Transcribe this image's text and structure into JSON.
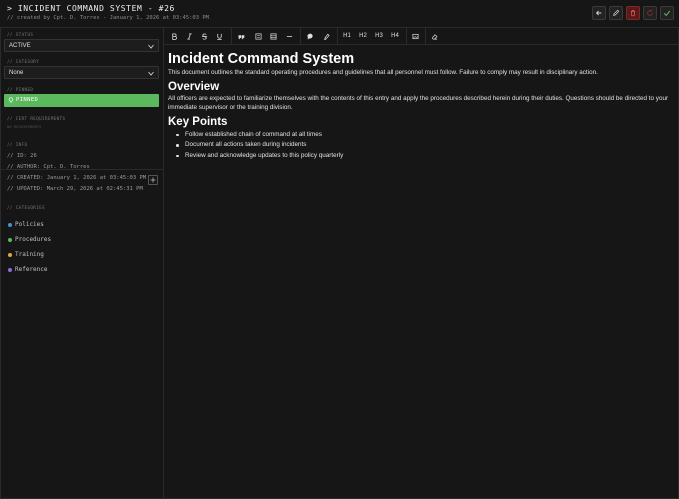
{
  "header": {
    "title": "> INCIDENT COMMAND SYSTEM - #26",
    "subtitle": "// created by Cpt. D. Torres - January 1, 2026 at 03:45:03 PM",
    "buttons": [
      "back-icon",
      "pencil-icon",
      "trash-icon",
      "refresh-icon",
      "check-icon"
    ]
  },
  "sidebar": {
    "status": {
      "label": "// STATUS",
      "value": "ACTIVE"
    },
    "category": {
      "label": "// CATEGORY",
      "value": "None"
    },
    "pinned": {
      "label": "// PINNED",
      "value": "PINNED"
    },
    "cert": {
      "label": "// CERT REQUIREMENTS",
      "value": "NO REQUIREMENTS"
    },
    "info": {
      "label": "// INFO",
      "id": "// ID: 26",
      "author": "// AUTHOR: Cpt. D. Torres",
      "created": "// CREATED: January 1, 2026 at 03:45:03 PM",
      "updated": "// UPDATED: March 29, 2026 at 02:45:31 PM"
    },
    "categories": {
      "label": "// CATEGORIES",
      "items": [
        {
          "name": "Policies",
          "color": "#4a90d9"
        },
        {
          "name": "Procedures",
          "color": "#5cb85c"
        },
        {
          "name": "Training",
          "color": "#e8a33d"
        },
        {
          "name": "Reference",
          "color": "#8a6fd6"
        }
      ]
    }
  },
  "toolbar": {
    "h1": "H1",
    "h2": "H2",
    "h3": "H3",
    "h4": "H4"
  },
  "document": {
    "title": "Incident Command System",
    "intro": "This document outlines the standard operating procedures and guidelines that all personnel must follow. Failure to comply may result in disciplinary action.",
    "overview_heading": "Overview",
    "overview_text": "All officers are expected to familiarize themselves with the contents of this entry and apply the procedures described herein during their duties. Questions should be directed to your immediate supervisor or the training division.",
    "keypoints_heading": "Key Points",
    "keypoints": [
      "Follow established chain of command at all times",
      "Document all actions taken during incidents",
      "Review and acknowledge updates to this policy quarterly"
    ]
  },
  "colors": {
    "accent_green": "#5cb85c",
    "danger": "#c0392b",
    "background": "#161616"
  }
}
